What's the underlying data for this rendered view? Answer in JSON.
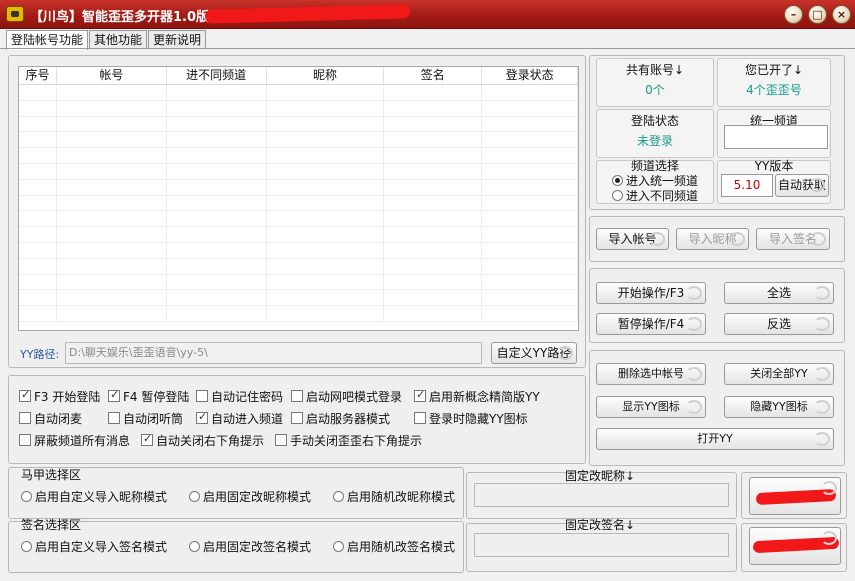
{
  "title": "【川鸟】智能歪歪多开器1.0版  (",
  "tabs": [
    "登陆帐号功能",
    "其他功能",
    "更新说明"
  ],
  "table": {
    "headers": [
      "序号",
      "帐号",
      "进不同频道",
      "昵称",
      "签名",
      "登录状态"
    ]
  },
  "path": {
    "label": "YY路径:",
    "value": "D:\\聊天娱乐\\歪歪语音\\yy-5\\",
    "button": "自定义YY路径"
  },
  "options": {
    "f3": "F3 开始登陆",
    "f4": "F4 暂停登陆",
    "remember_pwd": "自动记住密码",
    "netcafe": "启动网吧模式登录",
    "new_concept": "启用新概念精简版YY",
    "auto_mute": "自动闭麦",
    "auto_close_listen": "自动闭听筒",
    "auto_enter": "自动进入频道",
    "server_mode": "启动服务器模式",
    "hide_icon_login": "登录时隐藏YY图标",
    "block_msgs": "屏蔽频道所有消息",
    "auto_close_tip": "自动关闭右下角提示",
    "manual_close_tip": "手动关闭歪歪右下角提示"
  },
  "majia": {
    "title": "马甲选择区",
    "r1": "启用自定义导入昵称模式",
    "r2": "启用固定改昵称模式",
    "r3": "启用随机改昵称模式",
    "fixed_label": "固定改昵称↓"
  },
  "sign": {
    "title": "签名选择区",
    "r1": "启用自定义导入签名模式",
    "r2": "启用固定改签名模式",
    "r3": "启用随机改签名模式",
    "fixed_label": "固定改签名↓"
  },
  "stats": {
    "total_label": "共有账号↓",
    "total_value": "0个",
    "opened_label": "您已开了↓",
    "opened_value": "4个歪歪号",
    "login_label": "登陆状态",
    "login_value": "未登录",
    "unify_label": "统一频道",
    "channel_label": "频道选择",
    "ch_r1": "进入统一频道",
    "ch_r2": "进入不同频道",
    "yyver_label": "YY版本",
    "yyver_value": "5.10",
    "auto_get": "自动获取"
  },
  "buttons": {
    "import_account": "导入帐号",
    "import_nick": "导入昵称",
    "import_sign": "导入签名",
    "start": "开始操作/F3",
    "select_all": "全选",
    "pause": "暂停操作/F4",
    "invert": "反选",
    "delete_selected": "删除选中帐号",
    "close_all": "关闭全部YY",
    "show_icon": "显示YY图标",
    "hide_icon": "隐藏YY图标",
    "open_yy": "打开YY"
  },
  "colors": {
    "titlebar": "#a31b15",
    "value_teal": "#1a9a8a",
    "version_red": "#cc0000",
    "redaction": "#f01818"
  }
}
